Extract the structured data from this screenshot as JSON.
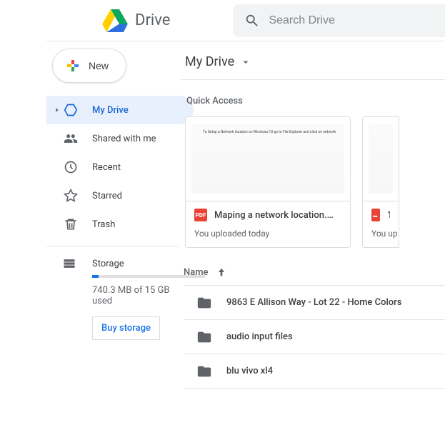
{
  "app": {
    "name": "Drive"
  },
  "search": {
    "placeholder": "Search Drive"
  },
  "newButton": {
    "label": "New"
  },
  "sidebar": {
    "items": [
      {
        "label": "My Drive",
        "icon": "my-drive-icon",
        "active": true
      },
      {
        "label": "Shared with me",
        "icon": "shared-icon"
      },
      {
        "label": "Recent",
        "icon": "recent-icon"
      },
      {
        "label": "Starred",
        "icon": "starred-icon"
      },
      {
        "label": "Trash",
        "icon": "trash-icon"
      }
    ],
    "storage": {
      "label": "Storage",
      "used_text": "740.3 MB of 15 GB used",
      "used_fraction": 0.048,
      "buy_label": "Buy storage"
    }
  },
  "breadcrumb": {
    "title": "My Drive"
  },
  "quickAccess": {
    "title": "Quick Access",
    "cards": [
      {
        "title": "Maping a network location.…",
        "subtitle": "You uploaded today",
        "badge": "PDF",
        "thumb_text": "To Setup a Network location on Windows 10 go to File Explorer and click on network"
      },
      {
        "title": "1.",
        "subtitle": "You up",
        "badge": "IMG"
      }
    ]
  },
  "fileList": {
    "header": {
      "name_label": "Name"
    },
    "rows": [
      {
        "name": "9863 E Allison Way - Lot 22 - Home Colors"
      },
      {
        "name": "audio input files"
      },
      {
        "name": "blu vivo xl4"
      }
    ]
  }
}
